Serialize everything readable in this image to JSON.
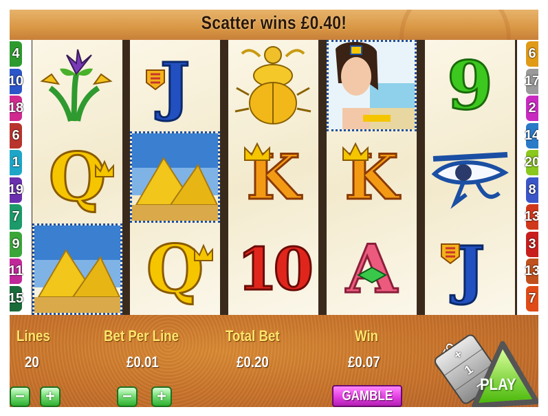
{
  "header": {
    "scatter_message": "Scatter wins £0.40!"
  },
  "left_line_numbers": [
    "4",
    "10",
    "18",
    "6",
    "1",
    "19",
    "7",
    "9",
    "11",
    "15"
  ],
  "right_line_numbers": [
    "6",
    "17",
    "2",
    "14",
    "20",
    "8",
    "13",
    "3",
    "13",
    "7"
  ],
  "left_line_colors": [
    "#2e9a2e",
    "#2b56c8",
    "#d02a8f",
    "#b8342c",
    "#1ea6c8",
    "#6a2fae",
    "#1c9a6a",
    "#3aa63a",
    "#c0289a",
    "#1a6b3a"
  ],
  "right_line_colors": [
    "#e09a16",
    "#9a9a9a",
    "#c82ac0",
    "#2a7ac8",
    "#8ac81e",
    "#3a56c8",
    "#d0381c",
    "#c81e1e",
    "#c0501e",
    "#e04a16"
  ],
  "reels": [
    [
      "lotus",
      "Q",
      "pyramids"
    ],
    [
      "J",
      "pyramids",
      "Q"
    ],
    [
      "scarab",
      "K",
      "10"
    ],
    [
      "cleopatra",
      "K",
      "A"
    ],
    [
      "9",
      "eye",
      "J"
    ]
  ],
  "panel": {
    "lines_label": "Lines",
    "lines_value": "20",
    "bet_per_line_label": "Bet Per Line",
    "bet_per_line_value": "£0.01",
    "total_bet_label": "Total Bet",
    "total_bet_value": "£0.20",
    "win_label": "Win",
    "win_value": "£0.07",
    "minus_symbol": "−",
    "plus_symbol": "+",
    "gamble_label": "GAMBLE",
    "auto_label": "AUTO",
    "auto_plus": "+",
    "auto_one": "1",
    "auto_minus": "−",
    "play_label": "PLAY"
  },
  "colors": {
    "accent_gold": "#ffe56a",
    "panel_orange": "#c8722a",
    "play_green": "#7ae81e",
    "gamble_magenta": "#e23fe2"
  }
}
